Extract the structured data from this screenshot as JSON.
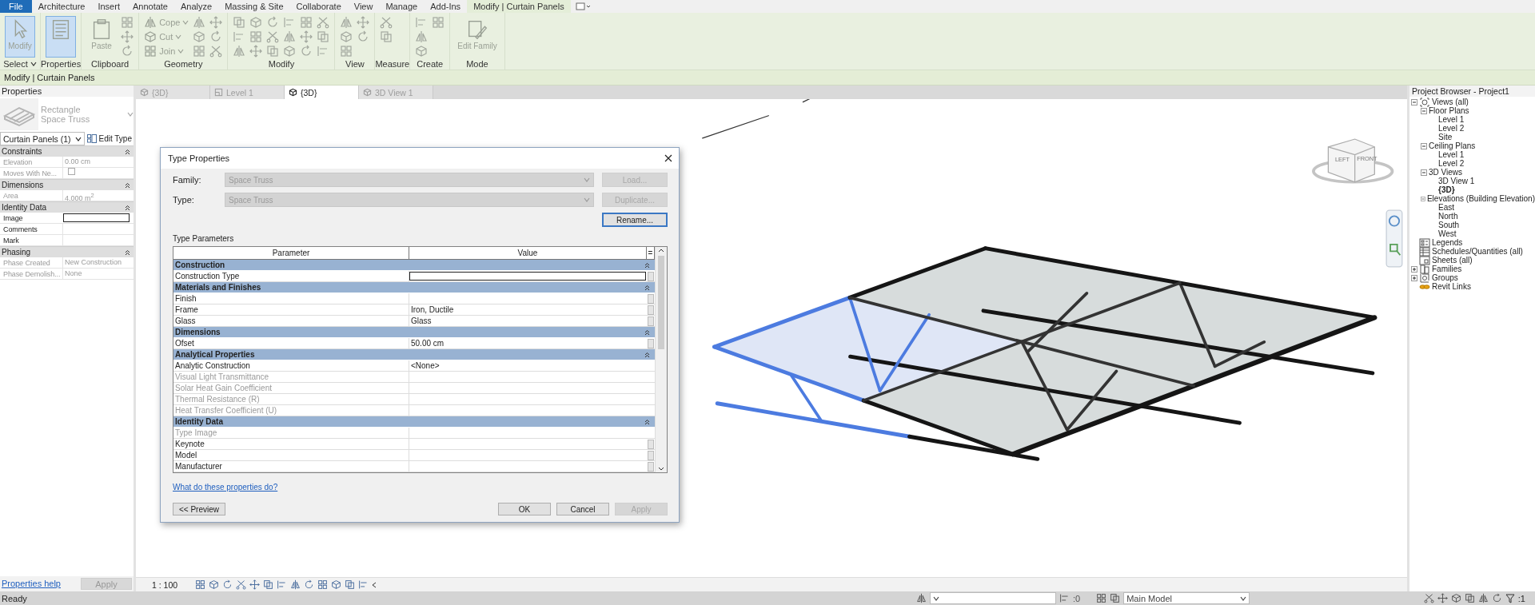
{
  "menu_tabs": [
    {
      "label": "File",
      "kind": "file",
      "selected": false
    },
    {
      "label": "Architecture",
      "kind": "tab",
      "selected": false
    },
    {
      "label": "Insert",
      "kind": "tab",
      "selected": false
    },
    {
      "label": "Annotate",
      "kind": "tab",
      "selected": false
    },
    {
      "label": "Analyze",
      "kind": "tab",
      "selected": false
    },
    {
      "label": "Massing & Site",
      "kind": "tab",
      "selected": false
    },
    {
      "label": "Collaborate",
      "kind": "tab",
      "selected": false
    },
    {
      "label": "View",
      "kind": "tab",
      "selected": false
    },
    {
      "label": "Manage",
      "kind": "tab",
      "selected": false
    },
    {
      "label": "Add-Ins",
      "kind": "tab",
      "selected": false
    },
    {
      "label": "Modify | Curtain Panels",
      "kind": "tab",
      "selected": true
    }
  ],
  "ribbon_panels": [
    {
      "title": "Select",
      "menu": true,
      "tools": [
        {
          "kind": "large",
          "label": "Modify",
          "selected": true
        }
      ]
    },
    {
      "title": "Properties",
      "tools": [
        {
          "kind": "large_icon",
          "selected": true
        }
      ]
    },
    {
      "title": "Clipboard",
      "tools": [
        {
          "kind": "large",
          "label": "Paste",
          "selected": false
        },
        {
          "kind": "icon"
        },
        {
          "kind": "icon"
        },
        {
          "kind": "icon"
        }
      ]
    },
    {
      "title": "Geometry",
      "tools": [
        {
          "kind": "small",
          "label": "Cope"
        },
        {
          "kind": "small",
          "label": "Cut"
        },
        {
          "kind": "small",
          "label": "Join"
        },
        {
          "kind": "icon"
        },
        {
          "kind": "icon"
        },
        {
          "kind": "icon"
        },
        {
          "kind": "icon"
        },
        {
          "kind": "icon"
        },
        {
          "kind": "icon"
        }
      ]
    },
    {
      "title": "Modify",
      "tools": [
        {
          "kind": "icon"
        },
        {
          "kind": "icon"
        },
        {
          "kind": "icon"
        },
        {
          "kind": "icon"
        },
        {
          "kind": "icon"
        },
        {
          "kind": "icon"
        },
        {
          "kind": "icon"
        },
        {
          "kind": "icon"
        },
        {
          "kind": "icon"
        },
        {
          "kind": "icon"
        },
        {
          "kind": "icon"
        },
        {
          "kind": "icon"
        },
        {
          "kind": "icon"
        },
        {
          "kind": "icon"
        },
        {
          "kind": "icon"
        },
        {
          "kind": "icon"
        },
        {
          "kind": "icon"
        },
        {
          "kind": "icon"
        }
      ]
    },
    {
      "title": "View",
      "tools": [
        {
          "kind": "icon"
        },
        {
          "kind": "icon"
        },
        {
          "kind": "icon"
        },
        {
          "kind": "icon"
        },
        {
          "kind": "icon"
        }
      ]
    },
    {
      "title": "Measure",
      "tools": [
        {
          "kind": "icon"
        },
        {
          "kind": "icon"
        }
      ]
    },
    {
      "title": "Create",
      "tools": [
        {
          "kind": "icon"
        },
        {
          "kind": "icon"
        },
        {
          "kind": "icon"
        },
        {
          "kind": "icon"
        }
      ]
    },
    {
      "title": "Mode",
      "tools": [
        {
          "kind": "large",
          "label": "Edit Family",
          "selected": false
        }
      ]
    }
  ],
  "context_bar": {
    "label": "Modify | Curtain Panels"
  },
  "properties": {
    "title": "Properties",
    "type_selector": {
      "family": "Rectangle",
      "type": "Space Truss"
    },
    "filter": "Curtain Panels (1)",
    "edit_type": "Edit Type",
    "groups": [
      {
        "title": "Constraints",
        "rows": [
          {
            "label": "Elevation",
            "value": "0.00 cm",
            "kind": "text",
            "disabled": true
          },
          {
            "label": "Moves With Ne...",
            "kind": "checkbox",
            "checked": false,
            "disabled": true
          }
        ]
      },
      {
        "title": "Dimensions",
        "rows": [
          {
            "label": "Area",
            "value": "4.000 m$^{2}$",
            "kind": "text",
            "disabled": true
          }
        ]
      },
      {
        "title": "Identity Data",
        "rows": [
          {
            "label": "Image",
            "kind": "field",
            "disabled": false
          },
          {
            "label": "Comments",
            "kind": "text",
            "disabled": false
          },
          {
            "label": "Mark",
            "kind": "text",
            "disabled": false
          }
        ]
      },
      {
        "title": "Phasing",
        "rows": [
          {
            "label": "Phase Created",
            "value": "New Construction",
            "kind": "text",
            "disabled": true
          },
          {
            "label": "Phase Demolish...",
            "value": "None",
            "kind": "text",
            "disabled": true
          }
        ]
      }
    ],
    "help_link": "Properties help",
    "apply": {
      "label": "Apply",
      "disabled": true
    }
  },
  "view_tabs": [
    {
      "label": "{3D}",
      "kind": "model",
      "selected": false
    },
    {
      "label": "Level 1",
      "kind": "plan",
      "selected": false
    },
    {
      "label": "{3D}",
      "kind": "model",
      "selected": true
    },
    {
      "label": "3D View 1",
      "kind": "model",
      "selected": false
    }
  ],
  "view_cube": {
    "faces": [
      "LEFT",
      "FRONT"
    ]
  },
  "dialog": {
    "title": "Type Properties",
    "selectors": [
      {
        "label": "Family:",
        "value": "Space Truss",
        "disabled": true
      },
      {
        "label": "Type:",
        "value": "Space Truss",
        "disabled": true
      }
    ],
    "side_buttons": [
      {
        "label": "Load...",
        "disabled": true
      },
      {
        "label": "Duplicate...",
        "disabled": true
      },
      {
        "label": "Rename...",
        "disabled": false
      }
    ],
    "section": "Type Parameters",
    "columns": [
      "Parameter",
      "Value",
      "="
    ],
    "groups": [
      {
        "title": "Construction",
        "rows": [
          {
            "parameter": "Construction Type",
            "kind": "field",
            "disabled": false
          }
        ]
      },
      {
        "title": "Materials and Finishes",
        "rows": [
          {
            "parameter": "Finish",
            "kind": "button",
            "disabled": false
          },
          {
            "parameter": "Frame",
            "value": "Iron, Ductile",
            "kind": "button",
            "disabled": false
          },
          {
            "parameter": "Glass",
            "value": "Glass",
            "kind": "button",
            "disabled": false
          }
        ]
      },
      {
        "title": "Dimensions",
        "rows": [
          {
            "parameter": "Ofset",
            "value": "50.00 cm",
            "kind": "button",
            "disabled": false
          }
        ]
      },
      {
        "title": "Analytical Properties",
        "rows": [
          {
            "parameter": "Analytic Construction",
            "value": "<None>",
            "kind": "plain",
            "disabled": false
          },
          {
            "parameter": "Visual Light Transmittance",
            "kind": "plain",
            "disabled": true
          },
          {
            "parameter": "Solar Heat Gain Coefficient",
            "kind": "plain",
            "disabled": true
          },
          {
            "parameter": "Thermal Resistance (R)",
            "kind": "plain",
            "disabled": true
          },
          {
            "parameter": "Heat Transfer Coefficient (U)",
            "kind": "plain",
            "disabled": true
          }
        ]
      },
      {
        "title": "Identity Data",
        "rows": [
          {
            "parameter": "Type Image",
            "kind": "plain",
            "disabled": true
          },
          {
            "parameter": "Keynote",
            "kind": "button",
            "disabled": false
          },
          {
            "parameter": "Model",
            "kind": "button",
            "disabled": false
          },
          {
            "parameter": "Manufacturer",
            "kind": "button",
            "disabled": false
          }
        ]
      }
    ],
    "help_link": "What do these properties do?",
    "preview_button": "<< Preview",
    "buttons": [
      {
        "label": "OK",
        "disabled": false
      },
      {
        "label": "Cancel",
        "disabled": false
      },
      {
        "label": "Apply",
        "disabled": true
      }
    ]
  },
  "view_control_bar": {
    "scale": "1 : 100"
  },
  "project_browser": {
    "title": "Project Browser - Project1",
    "tree": [
      {
        "label": "Views (all)",
        "kind": "views",
        "expanded": true,
        "selected": false,
        "children": [
          {
            "label": "Floor Plans",
            "expanded": true,
            "selected": false,
            "children": [
              {
                "label": "Level 1",
                "selected": false
              },
              {
                "label": "Level 2",
                "selected": false
              },
              {
                "label": "Site",
                "selected": false
              }
            ]
          },
          {
            "label": "Ceiling Plans",
            "expanded": true,
            "selected": false,
            "children": [
              {
                "label": "Level 1",
                "selected": false
              },
              {
                "label": "Level 2",
                "selected": false
              }
            ]
          },
          {
            "label": "3D Views",
            "expanded": true,
            "selected": false,
            "children": [
              {
                "label": "3D View 1",
                "selected": false
              },
              {
                "label": "{3D}",
                "selected": true
              }
            ]
          },
          {
            "label": "Elevations (Building Elevation)",
            "expanded": true,
            "selected": false,
            "children": [
              {
                "label": "East",
                "selected": false
              },
              {
                "label": "North",
                "selected": false
              },
              {
                "label": "South",
                "selected": false
              },
              {
                "label": "West",
                "selected": false
              }
            ]
          }
        ]
      },
      {
        "label": "Legends",
        "kind": "legends",
        "selected": false
      },
      {
        "label": "Schedules/Quantities (all)",
        "kind": "schedules",
        "selected": false
      },
      {
        "label": "Sheets (all)",
        "kind": "sheets",
        "selected": false
      },
      {
        "label": "Families",
        "kind": "families",
        "expanded": false,
        "selected": false
      },
      {
        "label": "Groups",
        "kind": "groups",
        "expanded": false,
        "selected": false
      },
      {
        "label": "Revit Links",
        "kind": "links",
        "selected": false
      }
    ]
  },
  "status_bar": {
    "message": "Ready",
    "editable_requests": ":0",
    "design_option": "Main Model",
    "selection_count": ":1"
  }
}
